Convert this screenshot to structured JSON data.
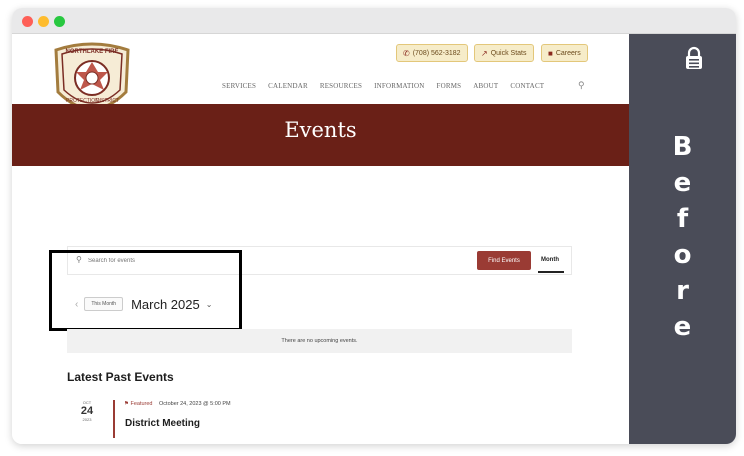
{
  "window": {
    "title": ""
  },
  "logo": {
    "top_text": "NORTHLAKE FIRE",
    "side_text": "PROTECTION",
    "right_text": "DISTRICT"
  },
  "utility": {
    "phone": "(708) 562-3182",
    "quick_stats": "Quick Stats",
    "careers": "Careers"
  },
  "nav": {
    "items": [
      "SERVICES",
      "CALENDAR",
      "RESOURCES",
      "INFORMATION",
      "FORMS",
      "ABOUT",
      "CONTACT"
    ]
  },
  "banner": {
    "title": "Events"
  },
  "search": {
    "placeholder": "Search for events",
    "find_label": "Find Events",
    "view_label": "Month"
  },
  "date_nav": {
    "this_month": "This Month",
    "title": "March 2025"
  },
  "notice": "There are no upcoming events.",
  "latest": {
    "heading": "Latest Past Events",
    "events": [
      {
        "month": "OCT",
        "day": "24",
        "year": "2023",
        "featured": "Featured",
        "datetime": "October 24, 2023 @ 5:00 PM",
        "title": "District Meeting"
      }
    ]
  },
  "side_label": {
    "letters": [
      "B",
      "e",
      "f",
      "o",
      "r",
      "e"
    ]
  },
  "colors": {
    "banner": "#6a2017",
    "accent": "#9a3b34",
    "side_panel": "#4a4c58",
    "highlight": "#000000"
  }
}
